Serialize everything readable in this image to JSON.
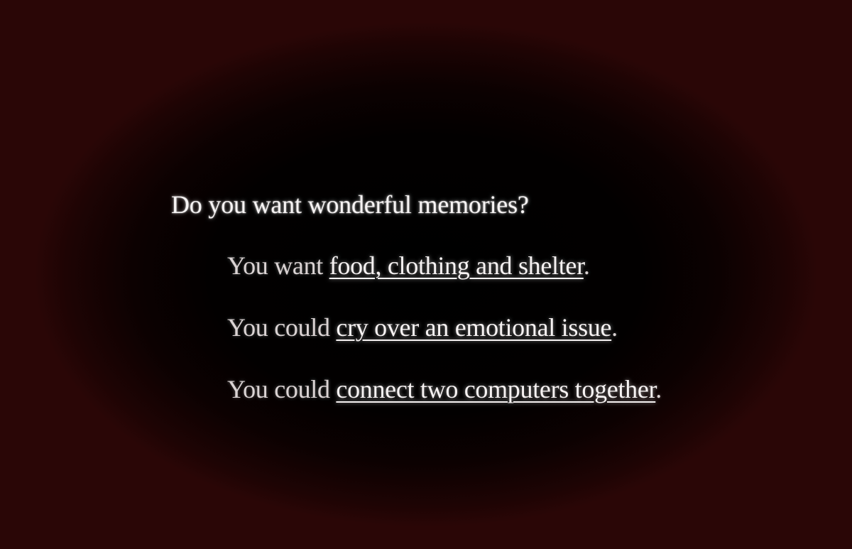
{
  "question": "Do you want wonderful memories?",
  "choices": [
    {
      "prefix": "You want ",
      "link": "food, clothing and shelter",
      "suffix": "."
    },
    {
      "prefix": "You could ",
      "link": "cry over an emotional issue",
      "suffix": "."
    },
    {
      "prefix": "You could ",
      "link": "connect two computers together",
      "suffix": "."
    }
  ],
  "colors": {
    "background_edge": "#2a0606",
    "background_center": "#000000",
    "text": "#f6f3f3"
  }
}
